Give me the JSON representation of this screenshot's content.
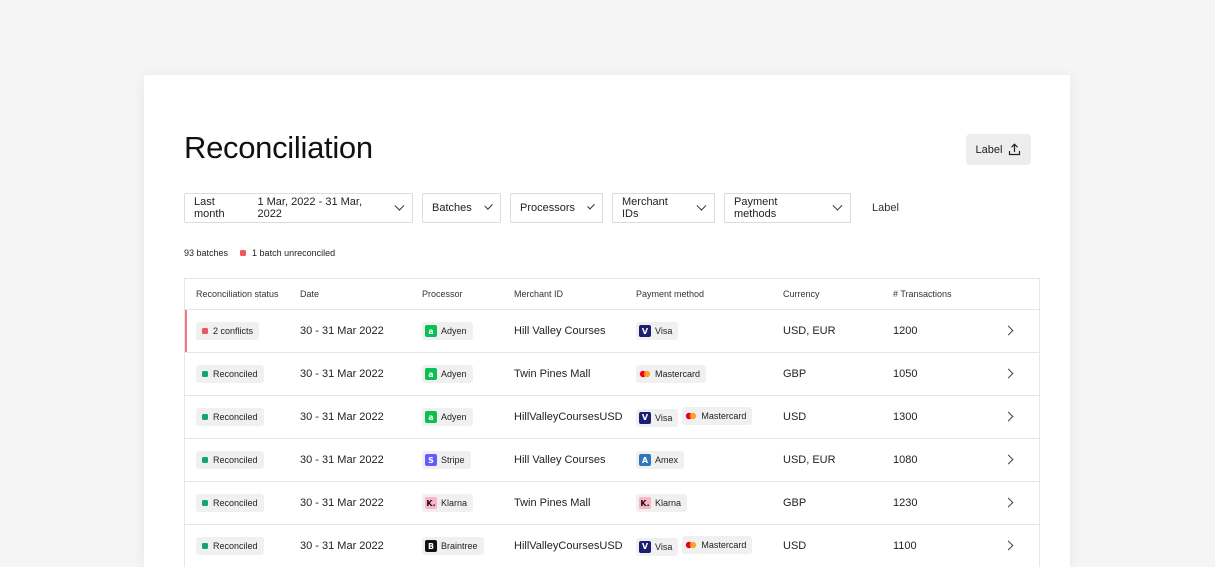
{
  "header": {
    "title": "Reconciliation",
    "action_label": "Label"
  },
  "filters": {
    "period_label": "Last month",
    "period_range": "1 Mar, 2022 - 31 Mar, 2022",
    "batches": "Batches",
    "processors": "Processors",
    "merchant_ids": "Merchant IDs",
    "payment_methods": "Payment methods",
    "label": "Label"
  },
  "summary": {
    "batches": "93 batches",
    "unreconciled": "1 batch unreconciled"
  },
  "table": {
    "columns": [
      "Reconciliation status",
      "Date",
      "Processor",
      "Merchant ID",
      "Payment method",
      "Currency",
      "# Transactions"
    ],
    "rows": [
      {
        "status": "2 conflicts",
        "status_color": "#f05561",
        "date": "30 - 31 Mar 2022",
        "processor": "Adyen",
        "processor_icon": "adyen-logo",
        "merchant": "Hill Valley Courses",
        "methods": [
          {
            "name": "Visa",
            "icon": "visa-logo"
          }
        ],
        "currency": "USD, EUR",
        "transactions": "1200"
      },
      {
        "status": "Reconciled",
        "status_color": "#16a37a",
        "date": "30 - 31 Mar 2022",
        "processor": "Adyen",
        "processor_icon": "adyen-logo",
        "merchant": "Twin Pines Mall",
        "methods": [
          {
            "name": "Mastercard",
            "icon": "mastercard-logo"
          }
        ],
        "currency": "GBP",
        "transactions": "1050"
      },
      {
        "status": "Reconciled",
        "status_color": "#16a37a",
        "date": "30 - 31 Mar 2022",
        "processor": "Adyen",
        "processor_icon": "adyen-logo",
        "merchant": "HillValleyCoursesUSD",
        "methods": [
          {
            "name": "Visa",
            "icon": "visa-logo"
          },
          {
            "name": "Mastercard",
            "icon": "mastercard-logo"
          }
        ],
        "currency": "USD",
        "transactions": "1300"
      },
      {
        "status": "Reconciled",
        "status_color": "#16a37a",
        "date": "30 - 31 Mar 2022",
        "processor": "Stripe",
        "processor_icon": "stripe-logo",
        "merchant": "Hill Valley Courses",
        "methods": [
          {
            "name": "Amex",
            "icon": "amex-logo"
          }
        ],
        "currency": "USD, EUR",
        "transactions": "1080"
      },
      {
        "status": "Reconciled",
        "status_color": "#16a37a",
        "date": "30 - 31 Mar 2022",
        "processor": "Klarna",
        "processor_icon": "klarna-logo",
        "merchant": "Twin Pines Mall",
        "methods": [
          {
            "name": "Klarna",
            "icon": "klarna-logo"
          }
        ],
        "currency": "GBP",
        "transactions": "1230"
      },
      {
        "status": "Reconciled",
        "status_color": "#16a37a",
        "date": "30 - 31 Mar 2022",
        "processor": "Braintree",
        "processor_icon": "braintree-logo",
        "merchant": "HillValleyCoursesUSD",
        "methods": [
          {
            "name": "Visa",
            "icon": "visa-logo"
          },
          {
            "name": "Mastercard",
            "icon": "mastercard-logo"
          }
        ],
        "currency": "USD",
        "transactions": "1100"
      }
    ]
  }
}
